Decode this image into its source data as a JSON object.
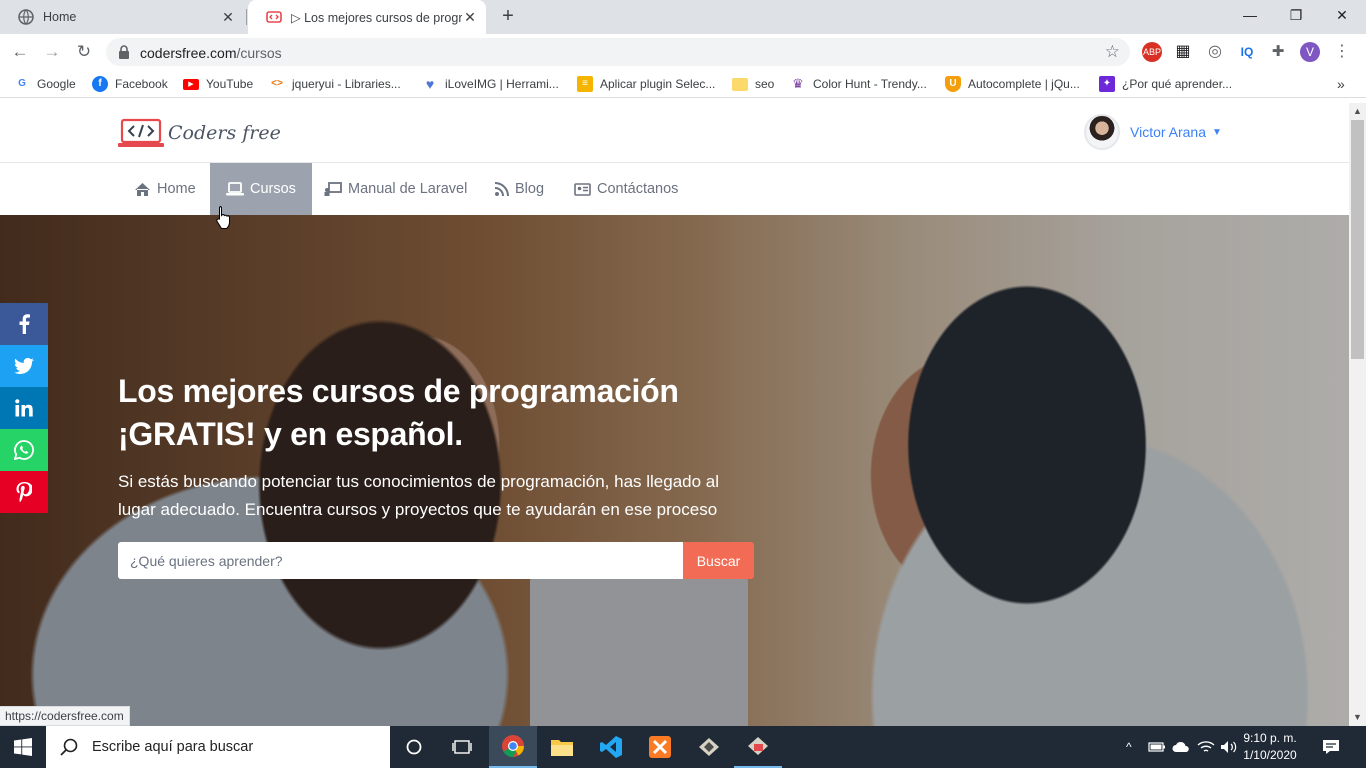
{
  "browser": {
    "tabs": [
      {
        "title": "Home"
      },
      {
        "title": "▷ Los mejores cursos de programación"
      }
    ],
    "url_host": "codersfree.com",
    "url_path": "/cursos",
    "bookmarks": [
      {
        "label": "Google",
        "icon": "google-icon",
        "color": "#4285f4"
      },
      {
        "label": "Facebook",
        "icon": "facebook-icon",
        "color": "#1877f2"
      },
      {
        "label": "YouTube",
        "icon": "youtube-icon",
        "color": "#ff0000"
      },
      {
        "label": "jqueryui - Libraries...",
        "icon": "code-icon",
        "color": "#e8710a"
      },
      {
        "label": "iLoveIMG | Herrami...",
        "icon": "heart-icon",
        "color": "#4f76d6"
      },
      {
        "label": "Aplicar plugin Selec...",
        "icon": "stack-icon",
        "color": "#f4b400"
      },
      {
        "label": "seo",
        "icon": "folder-icon",
        "color": "#fbd96b"
      },
      {
        "label": "Color Hunt - Trendy...",
        "icon": "colorhunt-icon",
        "color": "#7b3fa0"
      },
      {
        "label": "Autocomplete | jQu...",
        "icon": "shield-icon",
        "color": "#f59e0b"
      },
      {
        "label": "¿Por qué aprender...",
        "icon": "puzzle-icon",
        "color": "#6d28d9"
      }
    ],
    "overflow": "»"
  },
  "site": {
    "logo_text": "Coders free",
    "user_name": "Victor Arana",
    "nav": [
      {
        "label": "Home",
        "icon": "home-icon"
      },
      {
        "label": "Cursos",
        "icon": "laptop-icon",
        "active": true
      },
      {
        "label": "Manual de Laravel",
        "icon": "chalkboard-icon"
      },
      {
        "label": "Blog",
        "icon": "blog-icon"
      },
      {
        "label": "Contáctanos",
        "icon": "address-card-icon"
      }
    ],
    "hero": {
      "title_line1": "Los mejores cursos de programación",
      "title_line2": "¡GRATIS! y en español.",
      "subtitle": "Si estás buscando potenciar tus conocimientos de programación, has llegado al lugar adecuado. Encuentra cursos y proyectos que te ayudarán en ese proceso",
      "search_placeholder": "¿Qué quieres aprender?",
      "search_button": "Buscar"
    },
    "share": [
      {
        "label": "f",
        "icon": "facebook-icon",
        "color": "#3b5998"
      },
      {
        "label": "twitter",
        "icon": "twitter-icon",
        "color": "#1da1f2"
      },
      {
        "label": "in",
        "icon": "linkedin-icon",
        "color": "#0077b5"
      },
      {
        "label": "whatsapp",
        "icon": "whatsapp-icon",
        "color": "#25d366"
      },
      {
        "label": "P",
        "icon": "pinterest-icon",
        "color": "#e60023"
      }
    ],
    "status_url": "https://codersfree.com"
  },
  "taskbar": {
    "search_placeholder": "Escribe aquí para buscar",
    "time": "9:10 p. m.",
    "date": "1/10/2020"
  }
}
